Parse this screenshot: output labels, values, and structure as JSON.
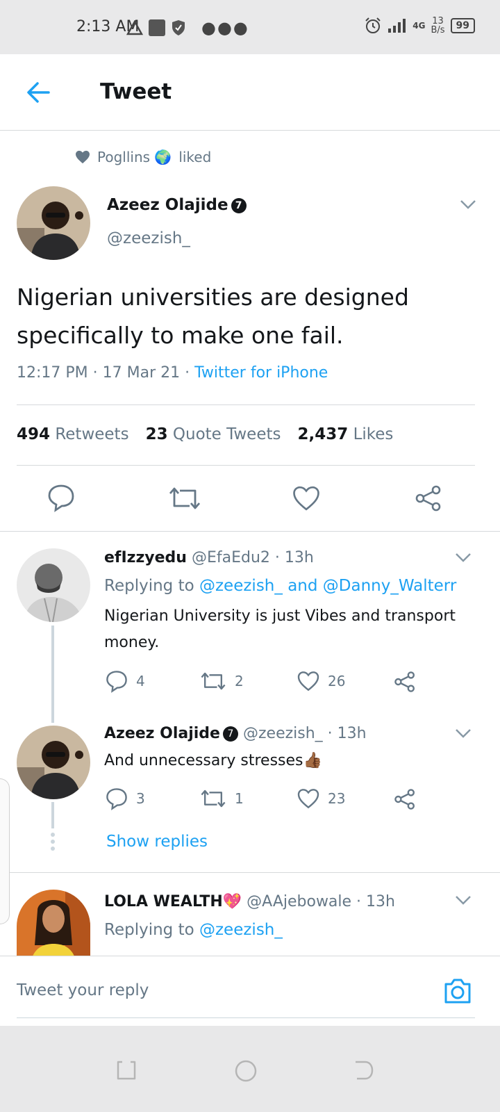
{
  "status_bar": {
    "time": "2:13 AM",
    "network": "4G",
    "speed": "13",
    "speed_unit": "B/s",
    "battery": "99"
  },
  "header": {
    "title": "Tweet"
  },
  "liked_by": {
    "name": "Pogllins 🌍",
    "suffix": "liked"
  },
  "tweet": {
    "author_name": "Azeez Olajide",
    "verified_badge": "7",
    "handle": "@zeezish_",
    "text": "Nigerian universities are designed specifically to make one fail.",
    "time": "12:17 PM · 17 Mar 21 · ",
    "source": "Twitter for iPhone",
    "retweets_count": "494",
    "retweets_label": "Retweets",
    "quotes_count": "23",
    "quotes_label": "Quote Tweets",
    "likes_count": "2,437",
    "likes_label": "Likes"
  },
  "replies": [
    {
      "name": "efIzzyedu",
      "handle": "@EfaEdu2 · 13h",
      "replying_prefix": "Replying to ",
      "replying_to": "@zeezish_ and @Danny_Walterr",
      "text": "Nigerian University is just Vibes and transport money.",
      "reply_count": "4",
      "retweet_count": "2",
      "like_count": "26"
    },
    {
      "name": "Azeez Olajide",
      "verified_badge": "7",
      "handle": "@zeezish_ · 13h",
      "text": "And unnecessary stresses👍🏾",
      "reply_count": "3",
      "retweet_count": "1",
      "like_count": "23",
      "show_replies": "Show replies"
    },
    {
      "name": "LOLA WEALTH💖",
      "handle": "@AAjebowale · 13h",
      "replying_prefix": "Replying to ",
      "replying_to": "@zeezish_"
    }
  ],
  "compose": {
    "placeholder": "Tweet your reply"
  },
  "colors": {
    "accent": "#1da1f2",
    "text": "#14171a",
    "secondary": "#657786",
    "divider": "#d6d9db"
  }
}
